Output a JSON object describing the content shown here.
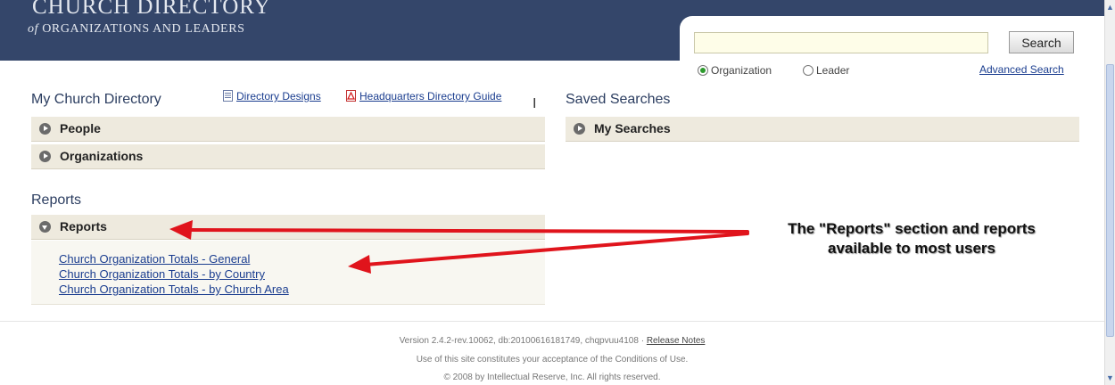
{
  "header": {
    "brand_title": "CHURCH DIRECTORY",
    "brand_sub_of": "of",
    "brand_sub_rest": " ORGANIZATIONS AND LEADERS"
  },
  "search": {
    "query": "",
    "button_label": "Search",
    "options": [
      {
        "label": "Organization",
        "selected": true
      },
      {
        "label": "Leader",
        "selected": false
      }
    ],
    "advanced_label": "Advanced Search"
  },
  "directory": {
    "title": "My Church Directory",
    "links": [
      "Directory Designs",
      "Headquarters Directory Guide"
    ],
    "sections": [
      "People",
      "Organizations"
    ]
  },
  "saved": {
    "title": "Saved Searches",
    "sections": [
      "My Searches"
    ]
  },
  "reports": {
    "title": "Reports",
    "section": "Reports",
    "items": [
      "Church Organization Totals - General",
      "Church Organization Totals - by Country",
      "Church Organization Totals - by Church Area"
    ]
  },
  "annotation": {
    "line1": "The \"Reports\" section and reports",
    "line2": "available to most users",
    "arrow_color": "#e0141c"
  },
  "footer": {
    "version": "Version 2.4.2-rev.10062, db:20100616181749, chqpvuu4108 · ",
    "release_notes": "Release Notes",
    "terms": "Use of this site constitutes your acceptance of the Conditions of Use.",
    "copyright": "© 2008 by Intellectual Reserve, Inc. All rights reserved."
  },
  "colors": {
    "header_bg": "#34466a",
    "bar_bg": "#eeeade",
    "link": "#1a3d8f"
  }
}
